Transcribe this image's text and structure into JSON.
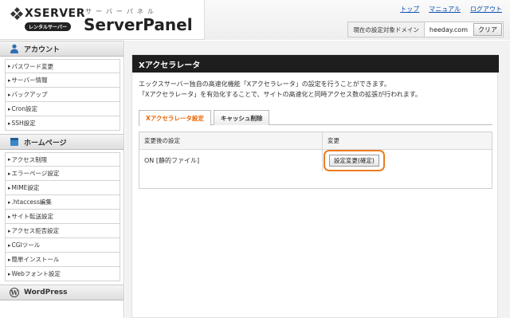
{
  "header": {
    "logo_word": "XSERVER",
    "logo_badge": "レンタルサーバー",
    "kana": "サーバーパネル",
    "title": "ServerPanel",
    "links": [
      "トップ",
      "マニュアル",
      "ログアウト"
    ],
    "domain_label": "現在の設定対象ドメイン",
    "domain_value": "heeday.com",
    "clear_label": "クリア"
  },
  "sidebar": {
    "sections": [
      {
        "label": "アカウント",
        "icon": "user-icon",
        "items": [
          "パスワード変更",
          "サーバー情報",
          "バックアップ",
          "Cron設定",
          "SSH設定"
        ]
      },
      {
        "label": "ホームページ",
        "icon": "homepage-icon",
        "items": [
          "アクセス制限",
          "エラーページ設定",
          "MIME設定",
          ".htaccess編集",
          "サイト転送設定",
          "アクセス拒否設定",
          "CGIツール",
          "簡単インストール",
          "Webフォント設定"
        ]
      },
      {
        "label": "WordPress",
        "icon": "wordpress-icon",
        "items": []
      }
    ]
  },
  "main": {
    "title": "Xアクセラレータ",
    "description": [
      "エックスサーバー独自の高速化機能「Xアクセラレータ」の設定を行うことができます。",
      "「Xアクセラレータ」を有効化することで、サイトの高速化と同時アクセス数の拡張が行われます。"
    ],
    "tabs": [
      {
        "label": "Xアクセラレータ設定",
        "active": true
      },
      {
        "label": "キャッシュ削除",
        "active": false
      }
    ],
    "table": {
      "headers": [
        "変更後の設定",
        "変更"
      ],
      "current_value": "ON [静的ファイル]",
      "confirm_label": "設定変更(確定)"
    }
  },
  "colors": {
    "accent": "#ee7b1f",
    "link": "#0a4fb0",
    "title_bar": "#1e1e1e"
  }
}
